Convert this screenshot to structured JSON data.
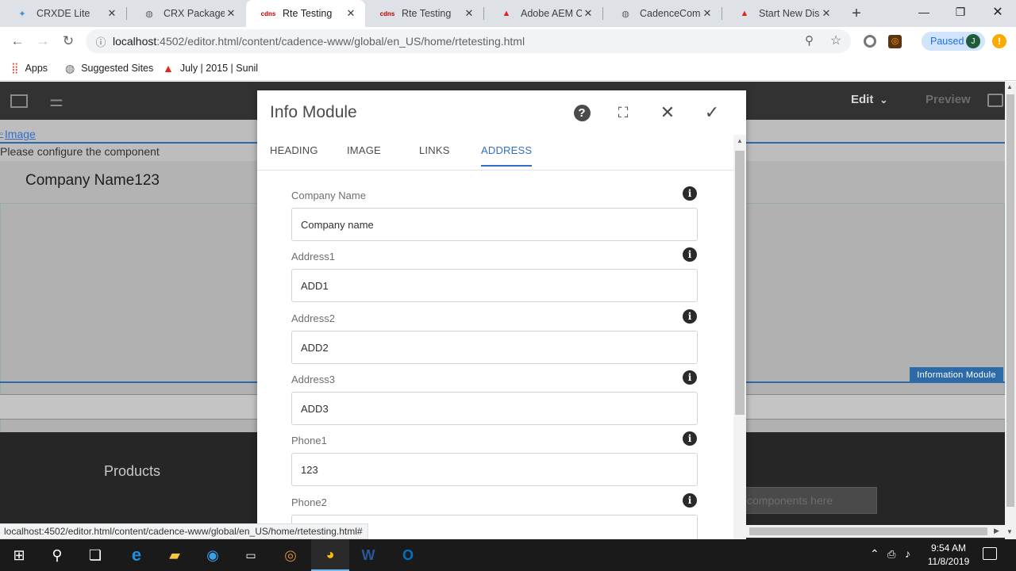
{
  "browser": {
    "tabs": [
      {
        "title": "CRXDE Lite",
        "icon": "crxde-icon",
        "active": false
      },
      {
        "title": "CRX Package Ma",
        "icon": "globe-icon",
        "active": false
      },
      {
        "title": "Rte Testing",
        "icon": "cdns-icon",
        "active": true
      },
      {
        "title": "Rte Testing",
        "icon": "cdns-icon",
        "active": false
      },
      {
        "title": "Adobe AEM CQ",
        "icon": "adobe-icon",
        "active": false
      },
      {
        "title": "CadenceCom - I",
        "icon": "globe-icon",
        "active": false
      },
      {
        "title": "Start New Discu",
        "icon": "adobe-icon",
        "active": false
      }
    ],
    "url_host": "localhost",
    "url_rest": ":4502/editor.html/content/cadence-www/global/en_US/home/rtetesting.html",
    "profile_status": "Paused",
    "profile_initial": "J",
    "bookmarks": [
      {
        "label": "Apps",
        "icon": "apps-grid-icon"
      },
      {
        "label": "Suggested Sites",
        "icon": "globe-icon"
      },
      {
        "label": "July | 2015 | Sunil",
        "icon": "adobe-icon"
      }
    ]
  },
  "editor": {
    "mode": "Edit",
    "preview": "Preview",
    "image_alt": "Image",
    "configure_msg": "Please configure the component",
    "company_heading": "Company Name123",
    "component_badge": "Information Module",
    "footer_products": "Products",
    "drag_hint": "components here"
  },
  "dialog": {
    "title": "Info Module",
    "tabs": [
      "HEADING",
      "IMAGE",
      "LINKS",
      "ADDRESS"
    ],
    "selected_tab": "ADDRESS",
    "fields": [
      {
        "label": "Company Name",
        "value": "Company name"
      },
      {
        "label": "Address1",
        "value": "ADD1"
      },
      {
        "label": "Address2",
        "value": "ADD2"
      },
      {
        "label": "Address3",
        "value": "ADD3"
      },
      {
        "label": "Phone1",
        "value": "123"
      },
      {
        "label": "Phone2",
        "value": ""
      }
    ]
  },
  "status_bar": {
    "url": "localhost:4502/editor.html/content/cadence-www/global/en_US/home/rtetesting.html#"
  },
  "taskbar": {
    "time": "9:54 AM",
    "date": "11/8/2019"
  },
  "colors": {
    "accent": "#326ec8",
    "aem_header": "#323232",
    "badge": "#2d6ba8"
  }
}
